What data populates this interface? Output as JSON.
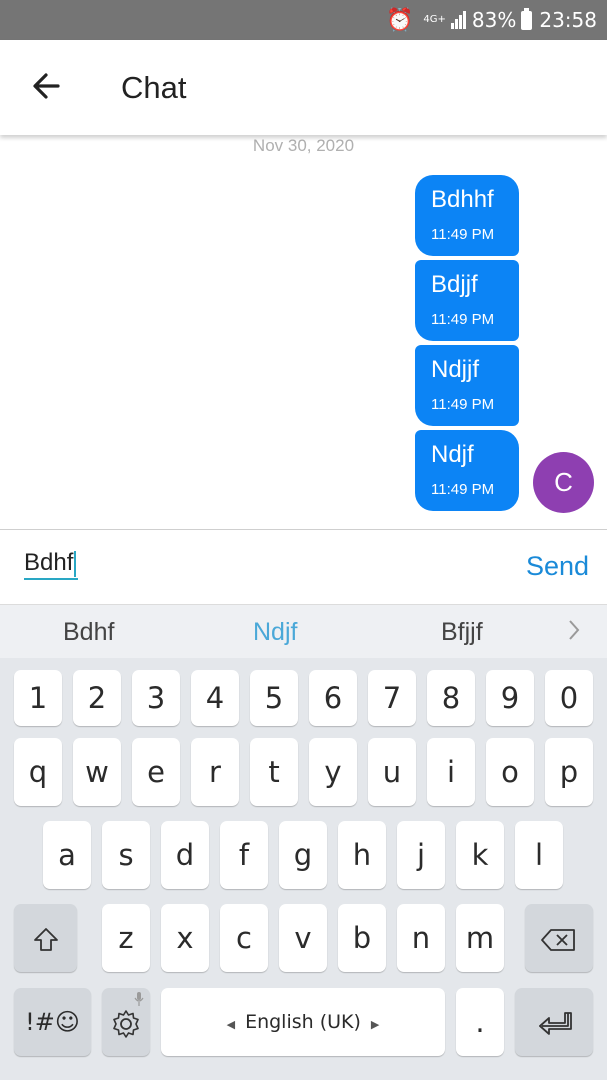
{
  "status_bar": {
    "alarm_icon": "alarm-clock-icon",
    "network": "4G+",
    "battery_percent": "83%",
    "time": "23:58"
  },
  "app_bar": {
    "back_icon": "arrow-left-icon",
    "title": "Chat"
  },
  "chat": {
    "date": "Nov 30, 2020",
    "messages": [
      {
        "text": "Bdhhf",
        "time": "11:49 PM"
      },
      {
        "text": "Bdjjf",
        "time": "11:49 PM"
      },
      {
        "text": "Ndjjf",
        "time": "11:49 PM"
      },
      {
        "text": "Ndjf",
        "time": "11:49 PM"
      }
    ],
    "avatar_letter": "C",
    "bubble_color": "#0c84f5",
    "avatar_color": "#8e3fb1"
  },
  "composer": {
    "input_value": "Bdhf",
    "send_label": "Send"
  },
  "keyboard": {
    "suggestions": [
      "Bdhf",
      "Ndjf",
      "Bfjjf"
    ],
    "suggestion_more_icon": "chevron-right-icon",
    "number_row": [
      "1",
      "2",
      "3",
      "4",
      "5",
      "6",
      "7",
      "8",
      "9",
      "0"
    ],
    "row1": [
      "q",
      "w",
      "e",
      "r",
      "t",
      "y",
      "u",
      "i",
      "o",
      "p"
    ],
    "row2": [
      "a",
      "s",
      "d",
      "f",
      "g",
      "h",
      "j",
      "k",
      "l"
    ],
    "row3": [
      "z",
      "x",
      "c",
      "v",
      "b",
      "n",
      "m"
    ],
    "shift_icon": "shift-icon",
    "backspace_icon": "backspace-icon",
    "symbols_label": "!#☺",
    "settings_icon": "gear-icon",
    "space_label": "English (UK)",
    "period_label": ".",
    "enter_icon": "enter-icon"
  }
}
